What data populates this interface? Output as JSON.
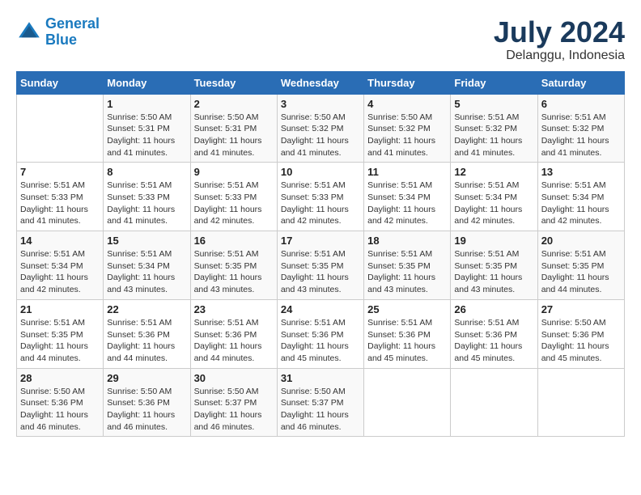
{
  "header": {
    "logo_line1": "General",
    "logo_line2": "Blue",
    "month_title": "July 2024",
    "location": "Delanggu, Indonesia"
  },
  "weekdays": [
    "Sunday",
    "Monday",
    "Tuesday",
    "Wednesday",
    "Thursday",
    "Friday",
    "Saturday"
  ],
  "weeks": [
    [
      {
        "day": "",
        "info": ""
      },
      {
        "day": "1",
        "info": "Sunrise: 5:50 AM\nSunset: 5:31 PM\nDaylight: 11 hours\nand 41 minutes."
      },
      {
        "day": "2",
        "info": "Sunrise: 5:50 AM\nSunset: 5:31 PM\nDaylight: 11 hours\nand 41 minutes."
      },
      {
        "day": "3",
        "info": "Sunrise: 5:50 AM\nSunset: 5:32 PM\nDaylight: 11 hours\nand 41 minutes."
      },
      {
        "day": "4",
        "info": "Sunrise: 5:50 AM\nSunset: 5:32 PM\nDaylight: 11 hours\nand 41 minutes."
      },
      {
        "day": "5",
        "info": "Sunrise: 5:51 AM\nSunset: 5:32 PM\nDaylight: 11 hours\nand 41 minutes."
      },
      {
        "day": "6",
        "info": "Sunrise: 5:51 AM\nSunset: 5:32 PM\nDaylight: 11 hours\nand 41 minutes."
      }
    ],
    [
      {
        "day": "7",
        "info": "Sunrise: 5:51 AM\nSunset: 5:33 PM\nDaylight: 11 hours\nand 41 minutes."
      },
      {
        "day": "8",
        "info": "Sunrise: 5:51 AM\nSunset: 5:33 PM\nDaylight: 11 hours\nand 41 minutes."
      },
      {
        "day": "9",
        "info": "Sunrise: 5:51 AM\nSunset: 5:33 PM\nDaylight: 11 hours\nand 42 minutes."
      },
      {
        "day": "10",
        "info": "Sunrise: 5:51 AM\nSunset: 5:33 PM\nDaylight: 11 hours\nand 42 minutes."
      },
      {
        "day": "11",
        "info": "Sunrise: 5:51 AM\nSunset: 5:34 PM\nDaylight: 11 hours\nand 42 minutes."
      },
      {
        "day": "12",
        "info": "Sunrise: 5:51 AM\nSunset: 5:34 PM\nDaylight: 11 hours\nand 42 minutes."
      },
      {
        "day": "13",
        "info": "Sunrise: 5:51 AM\nSunset: 5:34 PM\nDaylight: 11 hours\nand 42 minutes."
      }
    ],
    [
      {
        "day": "14",
        "info": "Sunrise: 5:51 AM\nSunset: 5:34 PM\nDaylight: 11 hours\nand 42 minutes."
      },
      {
        "day": "15",
        "info": "Sunrise: 5:51 AM\nSunset: 5:34 PM\nDaylight: 11 hours\nand 43 minutes."
      },
      {
        "day": "16",
        "info": "Sunrise: 5:51 AM\nSunset: 5:35 PM\nDaylight: 11 hours\nand 43 minutes."
      },
      {
        "day": "17",
        "info": "Sunrise: 5:51 AM\nSunset: 5:35 PM\nDaylight: 11 hours\nand 43 minutes."
      },
      {
        "day": "18",
        "info": "Sunrise: 5:51 AM\nSunset: 5:35 PM\nDaylight: 11 hours\nand 43 minutes."
      },
      {
        "day": "19",
        "info": "Sunrise: 5:51 AM\nSunset: 5:35 PM\nDaylight: 11 hours\nand 43 minutes."
      },
      {
        "day": "20",
        "info": "Sunrise: 5:51 AM\nSunset: 5:35 PM\nDaylight: 11 hours\nand 44 minutes."
      }
    ],
    [
      {
        "day": "21",
        "info": "Sunrise: 5:51 AM\nSunset: 5:35 PM\nDaylight: 11 hours\nand 44 minutes."
      },
      {
        "day": "22",
        "info": "Sunrise: 5:51 AM\nSunset: 5:36 PM\nDaylight: 11 hours\nand 44 minutes."
      },
      {
        "day": "23",
        "info": "Sunrise: 5:51 AM\nSunset: 5:36 PM\nDaylight: 11 hours\nand 44 minutes."
      },
      {
        "day": "24",
        "info": "Sunrise: 5:51 AM\nSunset: 5:36 PM\nDaylight: 11 hours\nand 45 minutes."
      },
      {
        "day": "25",
        "info": "Sunrise: 5:51 AM\nSunset: 5:36 PM\nDaylight: 11 hours\nand 45 minutes."
      },
      {
        "day": "26",
        "info": "Sunrise: 5:51 AM\nSunset: 5:36 PM\nDaylight: 11 hours\nand 45 minutes."
      },
      {
        "day": "27",
        "info": "Sunrise: 5:50 AM\nSunset: 5:36 PM\nDaylight: 11 hours\nand 45 minutes."
      }
    ],
    [
      {
        "day": "28",
        "info": "Sunrise: 5:50 AM\nSunset: 5:36 PM\nDaylight: 11 hours\nand 46 minutes."
      },
      {
        "day": "29",
        "info": "Sunrise: 5:50 AM\nSunset: 5:36 PM\nDaylight: 11 hours\nand 46 minutes."
      },
      {
        "day": "30",
        "info": "Sunrise: 5:50 AM\nSunset: 5:37 PM\nDaylight: 11 hours\nand 46 minutes."
      },
      {
        "day": "31",
        "info": "Sunrise: 5:50 AM\nSunset: 5:37 PM\nDaylight: 11 hours\nand 46 minutes."
      },
      {
        "day": "",
        "info": ""
      },
      {
        "day": "",
        "info": ""
      },
      {
        "day": "",
        "info": ""
      }
    ]
  ]
}
